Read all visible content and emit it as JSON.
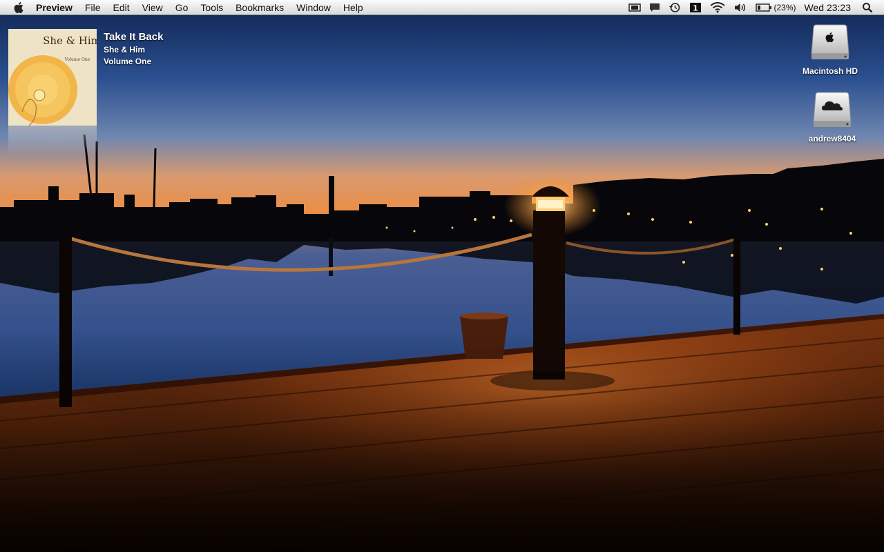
{
  "menubar": {
    "app_name": "Preview",
    "menus": [
      "File",
      "Edit",
      "View",
      "Go",
      "Tools",
      "Bookmarks",
      "Window",
      "Help"
    ],
    "status_icons": [
      "screen-mirroring-icon",
      "messages-icon",
      "time-machine-icon",
      "spaces-icon",
      "wifi-icon",
      "volume-icon",
      "battery-icon",
      "spotlight-icon"
    ],
    "spaces_number": "1",
    "battery_percent": "(23%)",
    "clock": "Wed 23:23"
  },
  "now_playing": {
    "title": "Take It Back",
    "artist": "She & Him",
    "album": "Volume One",
    "cover_text": "She & Him",
    "cover_subtext": "Volume One"
  },
  "desktop_icons": [
    {
      "label": "Macintosh HD",
      "icon": "hard-drive-icon"
    },
    {
      "label": "andrew8404",
      "icon": "cloud-drive-icon"
    }
  ],
  "colors": {
    "sky_top": "#1d3c7a",
    "sky_horizon": "#e8925a",
    "water": "#1f3c73",
    "dock_wood": "#8a3d12",
    "lamp_glow": "#ffd58a"
  }
}
